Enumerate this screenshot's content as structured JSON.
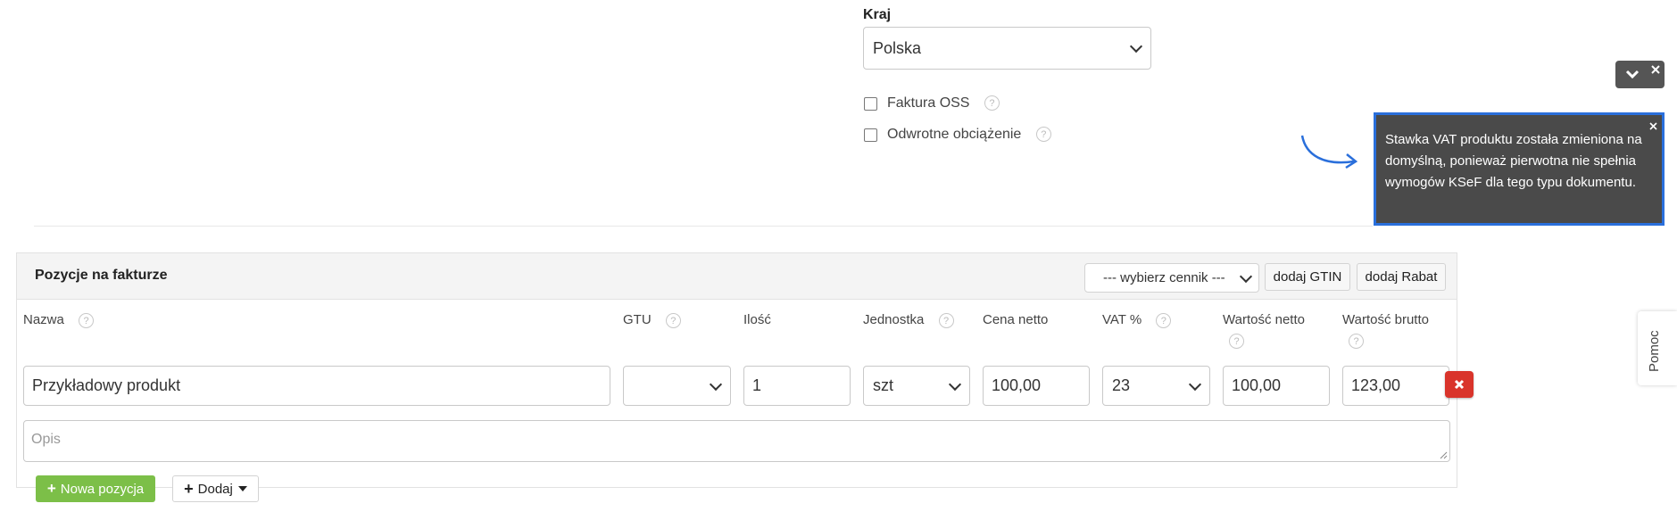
{
  "country": {
    "label": "Kraj",
    "selected": "Polska"
  },
  "checkboxes": [
    {
      "label": "Faktura OSS",
      "checked": false
    },
    {
      "label": "Odwrotne obciążenie",
      "checked": false
    }
  ],
  "toast": {
    "message": "Stawka VAT produktu została zmieniona na domyślną, ponieważ pierwotna nie spełnia wymogów KSeF dla tego typu dokumentu.",
    "border_color": "#2a6fdb",
    "bg_color": "#4a4a4a"
  },
  "invoice_items": {
    "title": "Pozycje na fakturze",
    "pricelist_select": "--- wybierz cennik ---",
    "add_gtin_label": "dodaj GTIN",
    "add_discount_label": "dodaj Rabat",
    "columns": {
      "name": "Nazwa",
      "gtu": "GTU",
      "qty": "Ilość",
      "unit": "Jednostka",
      "net_price": "Cena netto",
      "vat": "VAT %",
      "net_value": "Wartość netto",
      "gross_value": "Wartość brutto"
    },
    "row": {
      "name": "Przykładowy produkt",
      "gtu": "",
      "qty": "1",
      "unit": "szt",
      "net_price": "100,00",
      "vat": "23",
      "net_value": "100,00",
      "gross_value": "123,00"
    },
    "description_placeholder": "Opis",
    "new_item_label": "Nowa pozycja",
    "add_menu_label": "Dodaj",
    "new_item_color": "#7cbf48",
    "delete_color": "#d9342b"
  },
  "help_tab": {
    "label": "Pomoc"
  },
  "icons": {
    "help": "question-circle-icon",
    "close": "close-icon",
    "collapse": "chevron-down-icon",
    "delete": "remove-icon",
    "plus": "plus-icon",
    "arrow": "curved-arrow-icon"
  }
}
